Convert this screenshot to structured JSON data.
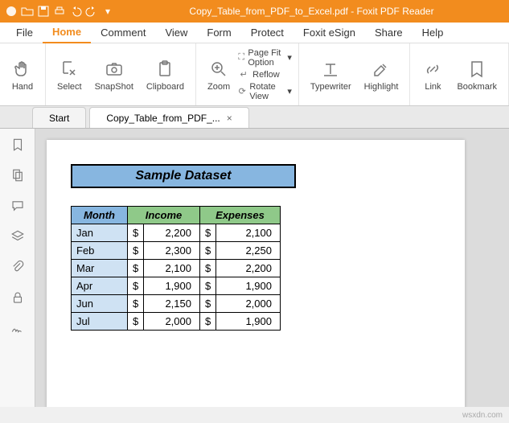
{
  "titlebar": {
    "filename": "Copy_Table_from_PDF_to_Excel.pdf",
    "appname": "Foxit PDF Reader"
  },
  "menu": {
    "file": "File",
    "home": "Home",
    "comment": "Comment",
    "view": "View",
    "form": "Form",
    "protect": "Protect",
    "esign": "Foxit eSign",
    "share": "Share",
    "help": "Help"
  },
  "ribbon": {
    "hand": "Hand",
    "select": "Select",
    "snapshot": "SnapShot",
    "clipboard": "Clipboard",
    "zoom": "Zoom",
    "pagefit": "Page Fit Option",
    "reflow": "Reflow",
    "rotate": "Rotate View",
    "typewriter": "Typewriter",
    "highlight": "Highlight",
    "link": "Link",
    "bookmark": "Bookmark"
  },
  "tabs": {
    "start": "Start",
    "doc": "Copy_Table_from_PDF_..."
  },
  "dataset": {
    "title": "Sample Dataset",
    "headers": {
      "month": "Month",
      "income": "Income",
      "expenses": "Expenses"
    },
    "currency": "$",
    "rows": [
      {
        "month": "Jan",
        "income": "2,200",
        "expenses": "2,100"
      },
      {
        "month": "Feb",
        "income": "2,300",
        "expenses": "2,250"
      },
      {
        "month": "Mar",
        "income": "2,100",
        "expenses": "2,200"
      },
      {
        "month": "Apr",
        "income": "1,900",
        "expenses": "1,900"
      },
      {
        "month": "Jun",
        "income": "2,150",
        "expenses": "2,000"
      },
      {
        "month": "Jul",
        "income": "2,000",
        "expenses": "1,900"
      }
    ]
  },
  "watermark": "wsxdn.com"
}
